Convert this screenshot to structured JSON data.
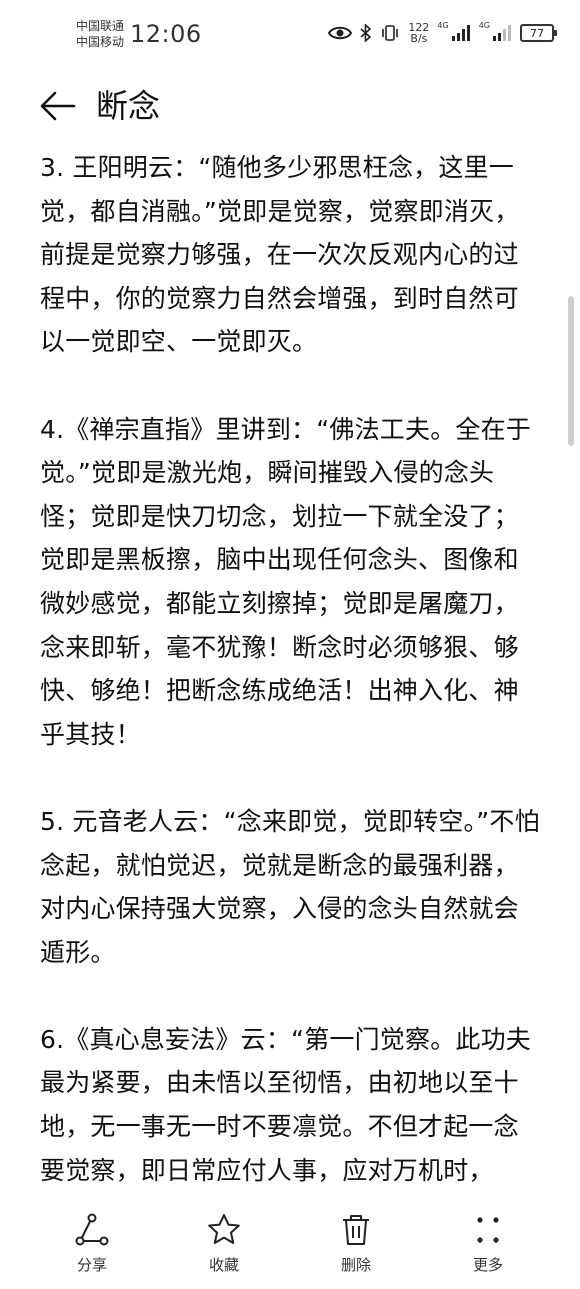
{
  "status_bar": {
    "carrier_1": "中国联通",
    "carrier_2": "中国移动",
    "time": "12:06",
    "net_speed_value": "122",
    "net_speed_unit": "B/s",
    "signal_1_label": "4G",
    "signal_2_label": "4G",
    "battery_level": "77"
  },
  "header": {
    "title": "断念"
  },
  "content": {
    "paragraphs": [
      "3. 王阳明云：“随他多少邪思枉念，这里一觉，都自消融。”觉即是觉察，觉察即消灭，前提是觉察力够强，在一次次反观内心的过程中，你的觉察力自然会增强，到时自然可以一觉即空、一觉即灭。",
      "4.《禅宗直指》里讲到：“佛法工夫。全在于觉。”觉即是激光炮，瞬间摧毁入侵的念头怪；觉即是快刀切念，划拉一下就全没了；觉即是黑板擦，脑中出现任何念头、图像和微妙感觉，都能立刻擦掉；觉即是屠魔刀，念来即斩，毫不犹豫！断念时必须够狠、够快、够绝！把断念练成绝活！出神入化、神乎其技！",
      "5. 元音老人云：“念来即觉，觉即转空。”不怕念起，就怕觉迟，觉就是断念的最强利器，对内心保持强大觉察，入侵的念头自然就会遁形。",
      "6.《真心息妄法》云：“第一门觉察。此功夫最为紧要，由未悟以至彻悟，由初地以至十地，无一事无一时不要凛觉。不但才起一念要觉察，即日常应付人事，应对万机时，"
    ]
  },
  "bottom_bar": {
    "share": "分享",
    "favorite": "收藏",
    "delete": "删除",
    "more": "更多"
  }
}
